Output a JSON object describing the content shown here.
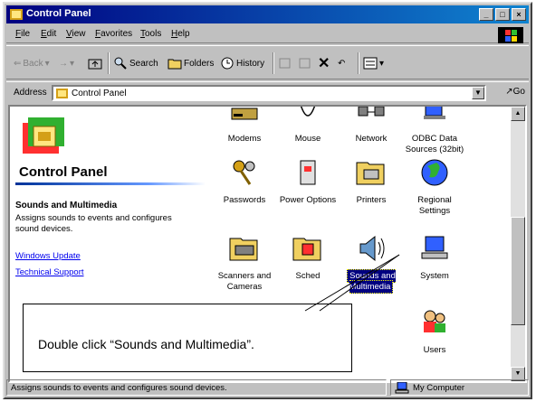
{
  "window": {
    "title": "Control Panel"
  },
  "menu": [
    "File",
    "Edit",
    "View",
    "Favorites",
    "Tools",
    "Help"
  ],
  "toolbar": {
    "back": "Back",
    "forward": "→",
    "up": "",
    "search": "Search",
    "folders": "Folders",
    "history": "History"
  },
  "address": {
    "label": "Address",
    "value": "Control Panel",
    "go": "Go"
  },
  "left_pane": {
    "title": "Control Panel",
    "selected_name": "Sounds and Multimedia",
    "selected_desc": "Assigns sounds to events and configures sound devices.",
    "links": [
      "Windows Update",
      "Technical Support"
    ]
  },
  "icons": [
    {
      "label": "Modems",
      "icon": "modem-icon"
    },
    {
      "label": "Mouse",
      "icon": "mouse-icon"
    },
    {
      "label": "Network",
      "icon": "network-icon"
    },
    {
      "label": "ODBC Data Sources (32bit)",
      "icon": "odbc-icon"
    },
    {
      "label": "Passwords",
      "icon": "keys-icon"
    },
    {
      "label": "Power Options",
      "icon": "power-icon"
    },
    {
      "label": "Printers",
      "icon": "printer-icon"
    },
    {
      "label": "Regional Settings",
      "icon": "globe-icon"
    },
    {
      "label": "Scanners and Cameras",
      "icon": "scanner-icon"
    },
    {
      "label": "Sched",
      "icon": "scheduled-tasks-icon"
    },
    {
      "label": "Sounds and Multimedia",
      "icon": "speaker-icon",
      "selected": true
    },
    {
      "label": "System",
      "icon": "computer-icon"
    },
    {
      "label": "Users",
      "icon": "users-icon"
    }
  ],
  "callout": {
    "text": "Double click “Sounds and Multimedia”."
  },
  "status": {
    "message": "Assigns sounds to events and configures sound devices.",
    "zone": "My Computer"
  },
  "colors": {
    "titlebar": "#000080",
    "selection": "#000080",
    "link": "#0000ee"
  }
}
